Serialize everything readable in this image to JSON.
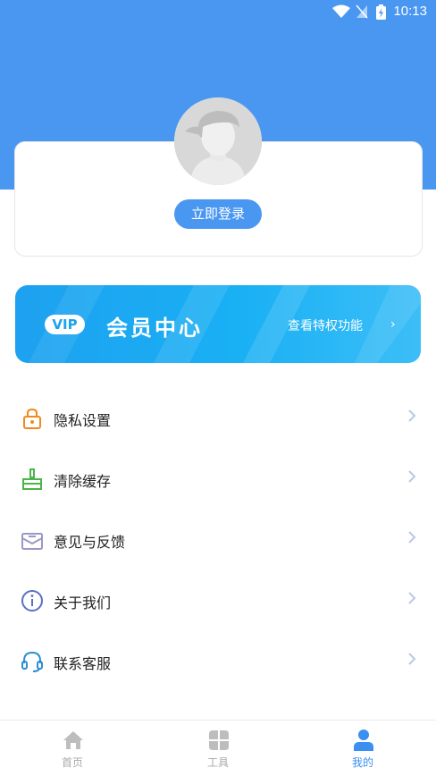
{
  "status_bar": {
    "time": "10:13"
  },
  "profile": {
    "login_label": "立即登录"
  },
  "vip": {
    "badge": "VIP",
    "title": "会员中心",
    "subtitle": "查看特权功能",
    "chevron": "›"
  },
  "menu": [
    {
      "label": "隐私设置",
      "icon": "lock-icon",
      "icon_color": "#f08a1e"
    },
    {
      "label": "清除缓存",
      "icon": "broom-icon",
      "icon_color": "#4cb54a"
    },
    {
      "label": "意见与反馈",
      "icon": "envelope-icon",
      "icon_color": "#9a98c8"
    },
    {
      "label": "关于我们",
      "icon": "info-icon",
      "icon_color": "#5a6fc4"
    },
    {
      "label": "联系客服",
      "icon": "headset-icon",
      "icon_color": "#2a8fd4"
    }
  ],
  "tabs": [
    {
      "label": "首页",
      "icon": "home-icon",
      "active": false
    },
    {
      "label": "工具",
      "icon": "tools-icon",
      "active": false
    },
    {
      "label": "我的",
      "icon": "user-icon",
      "active": true
    }
  ],
  "colors": {
    "primary": "#4a97f2",
    "vip_gradient": "#1ea1f0",
    "tab_active": "#3a8ff0",
    "tab_inactive": "#a9a9a9"
  }
}
